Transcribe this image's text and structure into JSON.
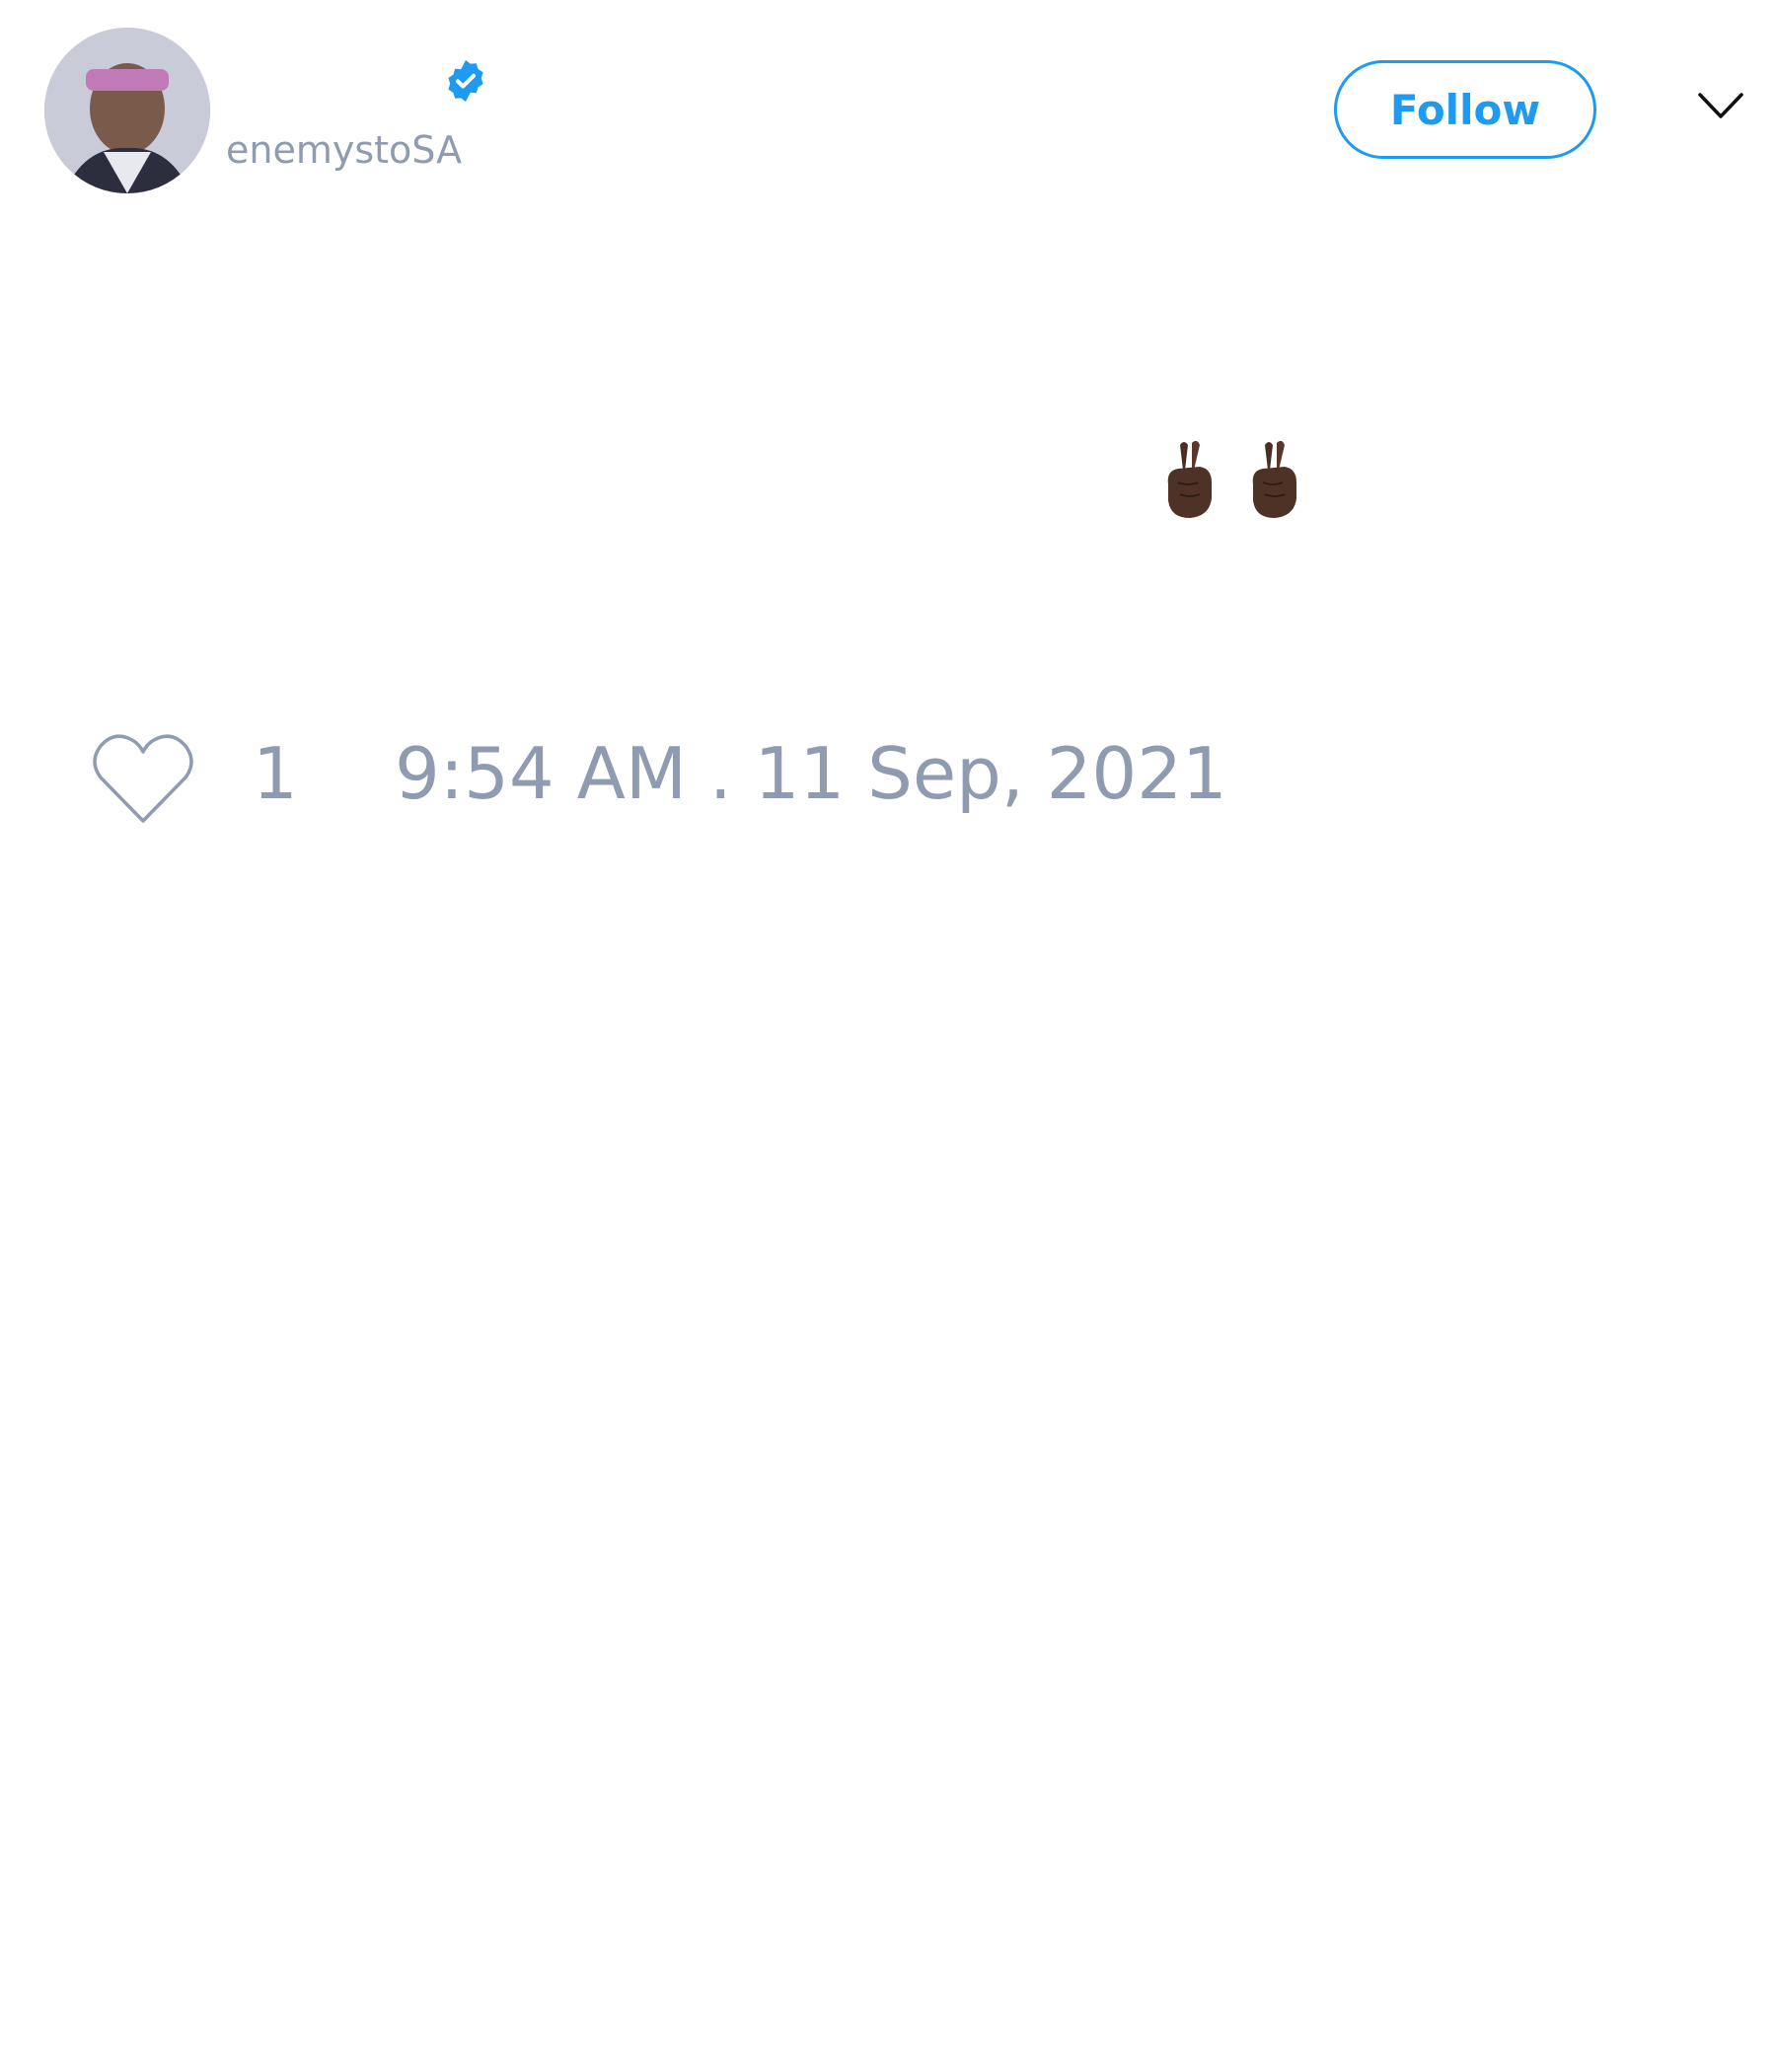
{
  "author": {
    "handle": "enemystoSA",
    "verified": true
  },
  "actions": {
    "follow_label": "Follow",
    "menu_icon": "chevron-down-icon"
  },
  "tweet": {
    "emoji": [
      "crossed-fingers-dark-skin",
      "crossed-fingers-dark-skin"
    ]
  },
  "footer": {
    "like_count": "1",
    "timestamp": "9:54 AM . 11 Sep, 2021"
  },
  "colors": {
    "accent": "#1d9bf0",
    "muted_text": "#8f9bb0"
  }
}
